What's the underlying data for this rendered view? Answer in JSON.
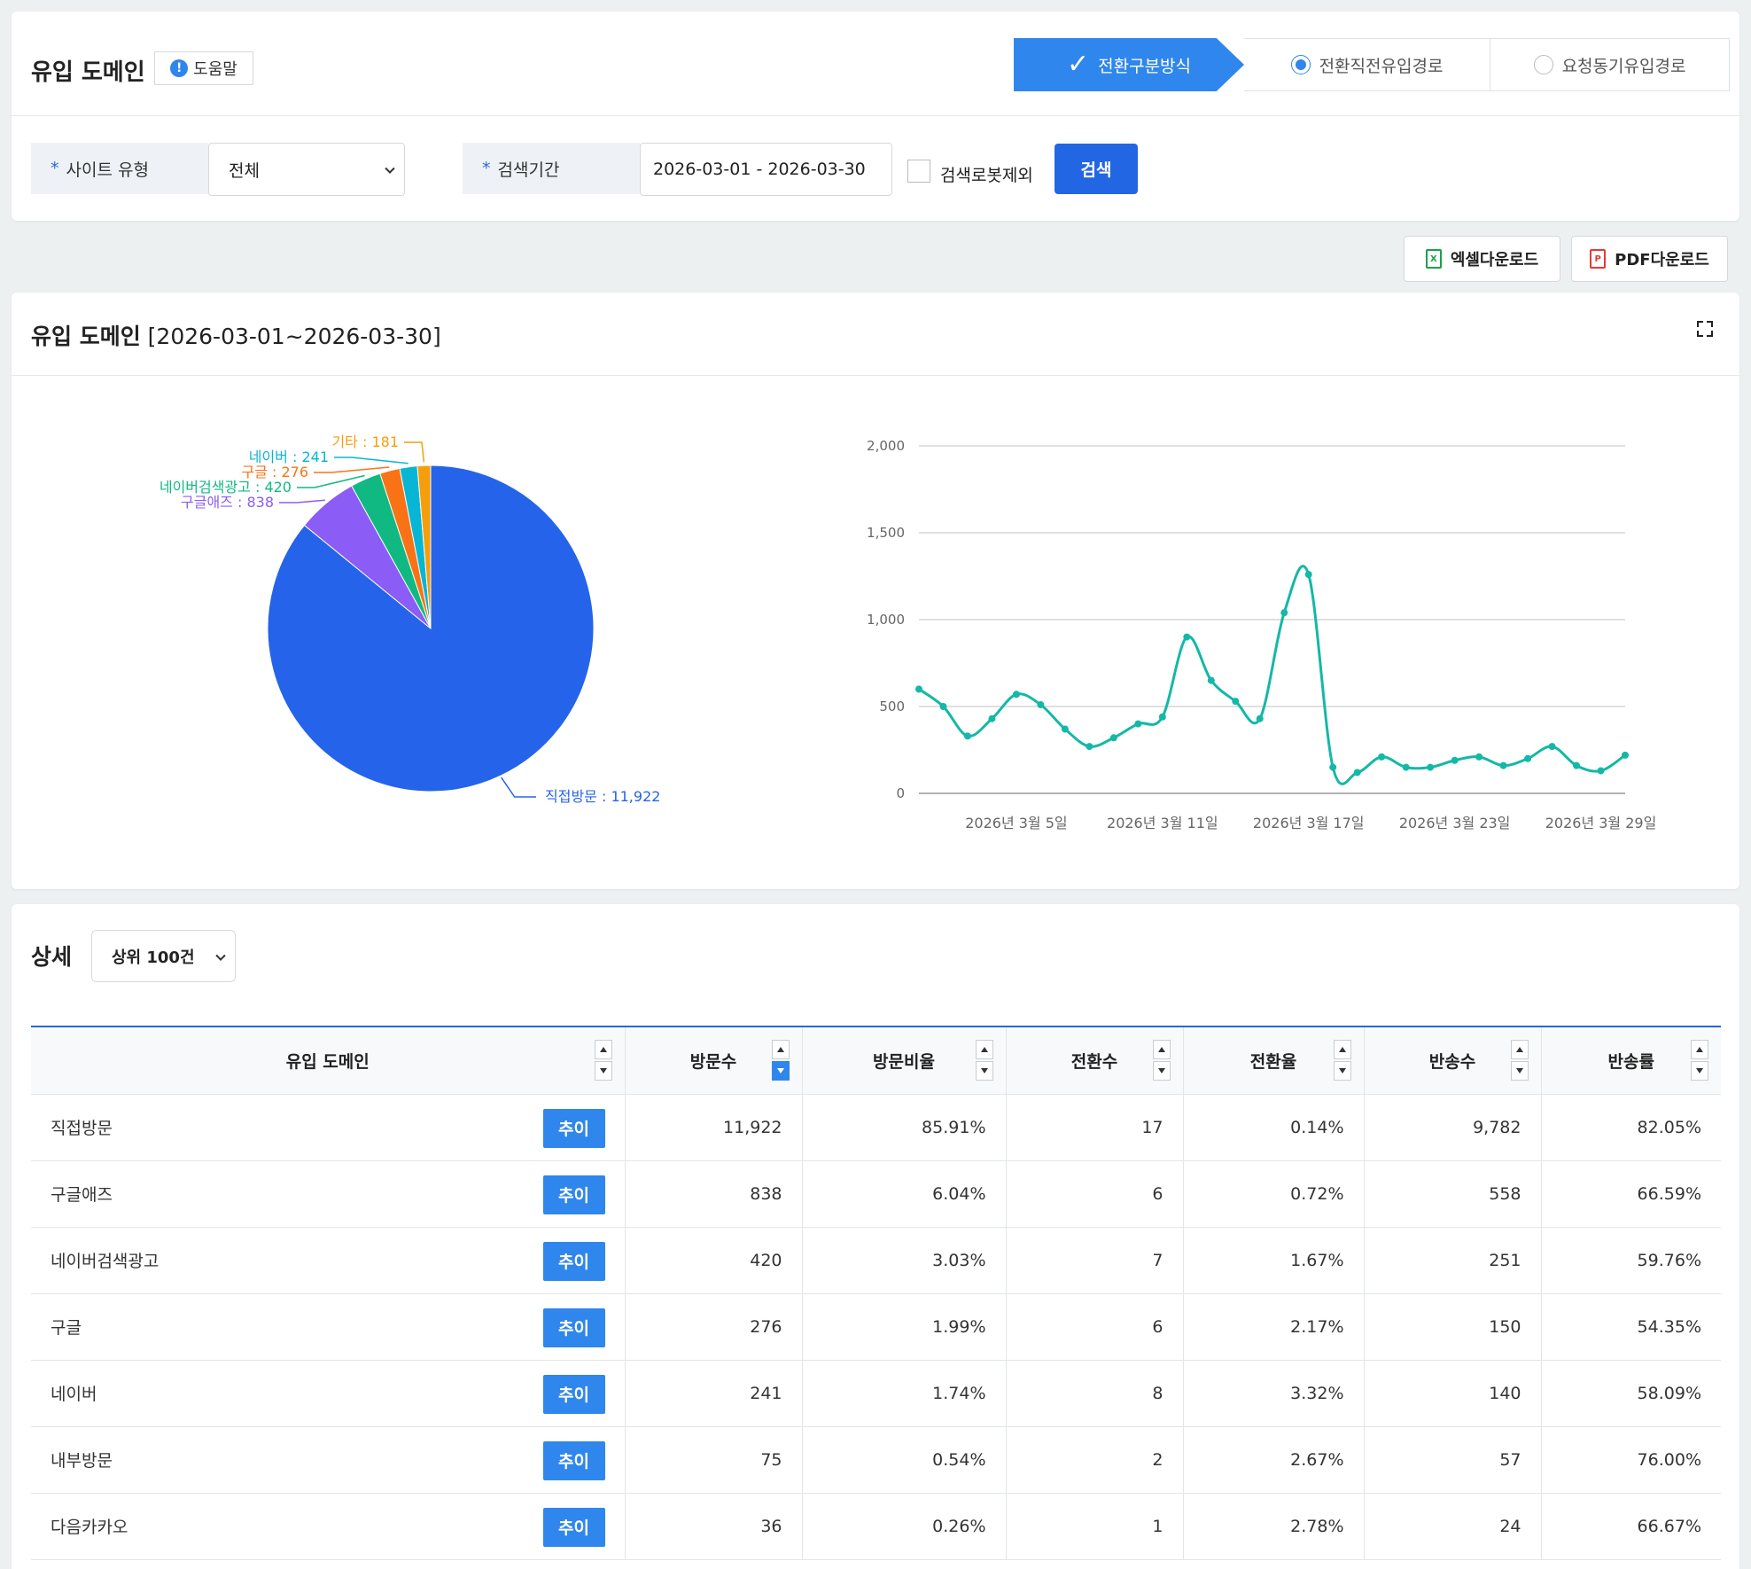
{
  "header": {
    "title": "유입 도메인",
    "help_label": "도움말",
    "modes": [
      {
        "label": "전환구분방식",
        "active": true
      },
      {
        "label": "전환직전유입경로",
        "selected": true
      },
      {
        "label": "요청동기유입경로",
        "selected": false
      }
    ]
  },
  "filters": {
    "site_type_label": "사이트 유형",
    "site_type_value": "전체",
    "period_label": "검색기간",
    "period_value": "2026-03-01 - 2026-03-30",
    "exclude_bot_label": "검색로봇제외",
    "exclude_bot_checked": false,
    "search_button": "검색",
    "required_mark": "*"
  },
  "downloads": {
    "excel_label": "엑셀다운로드",
    "pdf_label": "PDF다운로드"
  },
  "chart_panel": {
    "title": "유입 도메인",
    "range": "[2026-03-01~2026-03-30]"
  },
  "chart_data": [
    {
      "type": "pie",
      "labels": [
        "직접방문",
        "구글애즈",
        "네이버검색광고",
        "구글",
        "네이버",
        "기타"
      ],
      "values": [
        11922,
        838,
        420,
        276,
        241,
        181
      ],
      "display_labels": [
        "직접방문 : 11,922",
        "구글애즈 : 838",
        "네이버검색광고 : 420",
        "구글 : 276",
        "네이버 : 241",
        "기타 : 181"
      ],
      "colors": [
        "#2563eb",
        "#8b5cf6",
        "#10b981",
        "#f97316",
        "#06b6d4",
        "#f59e0b"
      ]
    },
    {
      "type": "line",
      "x": [
        "2026-03-01",
        "2026-03-02",
        "2026-03-03",
        "2026-03-04",
        "2026-03-05",
        "2026-03-06",
        "2026-03-07",
        "2026-03-08",
        "2026-03-09",
        "2026-03-10",
        "2026-03-11",
        "2026-03-12",
        "2026-03-13",
        "2026-03-14",
        "2026-03-15",
        "2026-03-16",
        "2026-03-17",
        "2026-03-18",
        "2026-03-19",
        "2026-03-20",
        "2026-03-21",
        "2026-03-22",
        "2026-03-23",
        "2026-03-24",
        "2026-03-25",
        "2026-03-26",
        "2026-03-27",
        "2026-03-28",
        "2026-03-29",
        "2026-03-30"
      ],
      "values": [
        600,
        500,
        330,
        430,
        570,
        510,
        370,
        270,
        320,
        400,
        440,
        900,
        650,
        530,
        430,
        1040,
        1260,
        150,
        120,
        210,
        150,
        150,
        190,
        210,
        160,
        200,
        270,
        160,
        130,
        220
      ],
      "ylim": [
        0,
        2000
      ],
      "yticks": [
        "0",
        "500",
        "1,000",
        "1,500",
        "2,000"
      ],
      "xtick_labels": [
        "2026년 3월 5일",
        "2026년 3월 11일",
        "2026년 3월 17일",
        "2026년 3월 23일",
        "2026년 3월 29일"
      ],
      "grid": true,
      "color": "#14b8a6"
    }
  ],
  "detail": {
    "title": "상세",
    "top_select": "상위 100건",
    "trend_label": "추이",
    "columns": [
      "유입 도메인",
      "방문수",
      "방문비율",
      "전환수",
      "전환율",
      "반송수",
      "반송률"
    ],
    "rows": [
      [
        "직접방문",
        "11,922",
        "85.91%",
        "17",
        "0.14%",
        "9,782",
        "82.05%"
      ],
      [
        "구글애즈",
        "838",
        "6.04%",
        "6",
        "0.72%",
        "558",
        "66.59%"
      ],
      [
        "네이버검색광고",
        "420",
        "3.03%",
        "7",
        "1.67%",
        "251",
        "59.76%"
      ],
      [
        "구글",
        "276",
        "1.99%",
        "6",
        "2.17%",
        "150",
        "54.35%"
      ],
      [
        "네이버",
        "241",
        "1.74%",
        "8",
        "3.32%",
        "140",
        "58.09%"
      ],
      [
        "내부방문",
        "75",
        "0.54%",
        "2",
        "2.67%",
        "57",
        "76.00%"
      ],
      [
        "다음카카오",
        "36",
        "0.26%",
        "1",
        "2.78%",
        "24",
        "66.67%"
      ]
    ]
  }
}
